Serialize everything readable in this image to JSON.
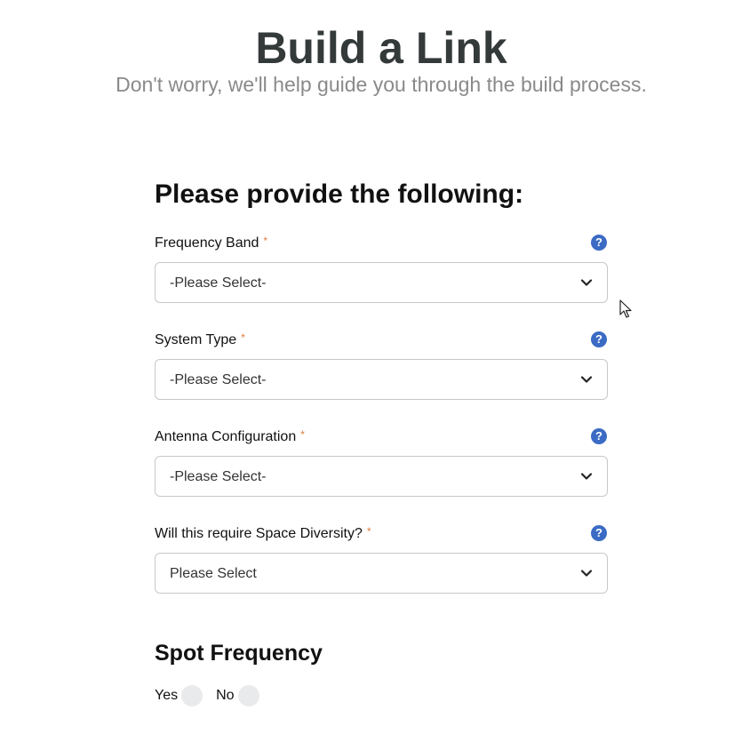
{
  "header": {
    "title": "Build a Link",
    "subtitle": "Don't worry, we'll help guide you through the build process."
  },
  "form": {
    "heading": "Please provide the following:",
    "required_marker": "*",
    "help_glyph": "?",
    "fields": [
      {
        "label": "Frequency Band",
        "value": "-Please Select-"
      },
      {
        "label": "System Type",
        "value": "-Please Select-"
      },
      {
        "label": "Antenna Configuration",
        "value": "-Please Select-"
      },
      {
        "label": "Will this require Space Diversity?",
        "value": "Please Select"
      }
    ]
  },
  "spot_frequency": {
    "heading": "Spot Frequency",
    "options": [
      {
        "label": "Yes",
        "selected": false
      },
      {
        "label": "No",
        "selected": false
      }
    ]
  },
  "colors": {
    "title": "#343a3a",
    "subtitle": "#8a8a8a",
    "required": "#e07a3a",
    "help_icon": "#3b6bc4",
    "border": "#c8c8c8",
    "radio": "#e8eaec"
  }
}
